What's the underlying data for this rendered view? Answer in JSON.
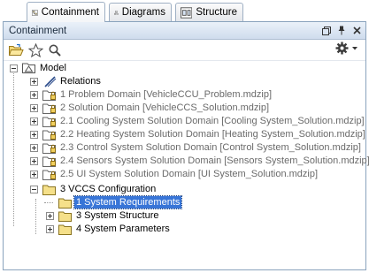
{
  "tabs": [
    {
      "label": "Containment",
      "icon": "containment-icon",
      "active": true
    },
    {
      "label": "Diagrams",
      "icon": "diagrams-icon",
      "active": false
    },
    {
      "label": "Structure",
      "icon": "structure-icon",
      "active": false
    }
  ],
  "panel": {
    "title": "Containment",
    "window_buttons": [
      "restore-icon",
      "pin-icon",
      "close-icon"
    ]
  },
  "toolbar": {
    "buttons": [
      "open-folder-icon",
      "star-icon",
      "search-icon"
    ],
    "options_icon": "gear-icon"
  },
  "tree": {
    "root": "Model",
    "items": [
      {
        "label": "Relations",
        "icon": "relations-icon",
        "expandable": true,
        "dim": false
      },
      {
        "label": "1 Problem Domain [VehicleCCU_Problem.mdzip]",
        "icon": "locked-package-icon",
        "expandable": true,
        "dim": true
      },
      {
        "label": "2 Solution Domain [VehicleCCS_Solution.mdzip]",
        "icon": "locked-package-icon",
        "expandable": true,
        "dim": true
      },
      {
        "label": "2.1 Cooling System Solution Domain [Cooling System_Solution.mdzip]",
        "icon": "locked-package-icon",
        "expandable": true,
        "dim": true
      },
      {
        "label": "2.2 Heating System Solution Domain [Heating System_Solution.mdzip]",
        "icon": "locked-package-icon",
        "expandable": true,
        "dim": true
      },
      {
        "label": "2.3 Control System Solution Domain [Control System_Solution.mdzip]",
        "icon": "locked-package-icon",
        "expandable": true,
        "dim": true
      },
      {
        "label": "2.4 Sensors System Solution Domain [Sensors System_Solution.mdzip]",
        "icon": "locked-package-icon",
        "expandable": true,
        "dim": true
      },
      {
        "label": "2.5 UI System Solution Domain [UI System_Solution.mdzip]",
        "icon": "locked-package-icon",
        "expandable": true,
        "dim": true
      },
      {
        "label": "3 VCCS Configuration",
        "icon": "package-icon",
        "expandable": true,
        "expanded": true,
        "dim": false
      },
      {
        "label": "1 System Requirements",
        "icon": "package-icon",
        "expandable": false,
        "selected": true,
        "dim": false
      },
      {
        "label": "3 System Structure",
        "icon": "package-icon",
        "expandable": true,
        "dim": false
      },
      {
        "label": "4 System Parameters",
        "icon": "package-icon",
        "expandable": true,
        "dim": false
      }
    ]
  },
  "colors": {
    "selection": "#3875d7",
    "folder": "#f5e08a",
    "titlebar": "#d6e2f0",
    "dim_text": "#6a6a6a"
  }
}
